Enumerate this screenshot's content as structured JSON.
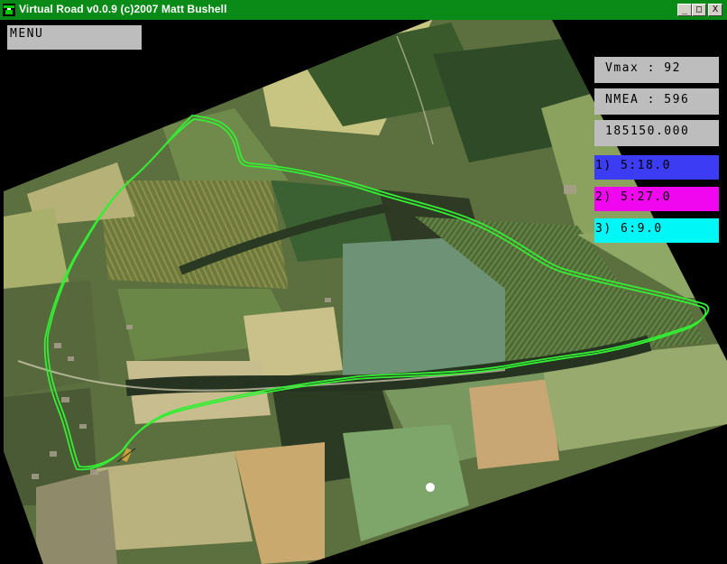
{
  "window": {
    "title": "Virtual Road v0.0.9 (c)2007 Matt Bushell",
    "controls": {
      "minimize": "_",
      "maximize": "□",
      "close": "X"
    }
  },
  "menu": {
    "label": "MENU"
  },
  "stats": {
    "vmax": "Vmax : 92",
    "nmea": "NMEA : 596",
    "time": "185150.000"
  },
  "laps": [
    {
      "label": "1) 5:18.0",
      "color": "#3c3cf5"
    },
    {
      "label": "2) 5:27.0",
      "color": "#f007f0"
    },
    {
      "label": "3) 6:9.0",
      "color": "#00f7f7"
    }
  ],
  "map": {
    "track_color": "#33ee33",
    "marker_color": "#ffffff",
    "icons": [
      "app-icon",
      "car-marker-icon",
      "position-dot-icon"
    ]
  },
  "colors": {
    "titlebar": "#0a8a17",
    "hud_grey": "#bdbdbd"
  }
}
